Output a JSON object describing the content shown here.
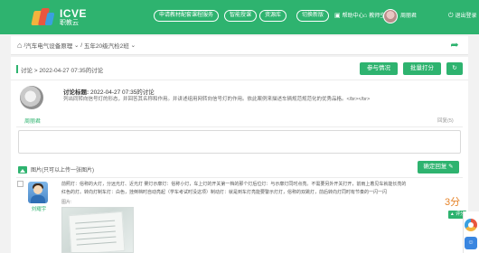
{
  "brand": {
    "name_en": "ICVE",
    "name_cn": "职教云"
  },
  "nav": {
    "pill_links": [
      "申请教材配套课程服务",
      "智能授课",
      "资源库",
      "切换新版"
    ],
    "help": "帮助中心",
    "teacher_space": "教师空间",
    "username": "周丽君",
    "logout": "退出登录"
  },
  "breadcrumb": {
    "course": "汽车电气设备原理",
    "clazz": "五年20级汽检2班"
  },
  "topic": {
    "crumb": "讨论  > 2022-04-27 07:35的讨论",
    "btn_participation": "参与情况",
    "btn_batch_score": "批量打分",
    "btn_refresh_icon": "↻",
    "author": "周丽君",
    "title_label": "讨论标题:",
    "title_value": "2022-04-27 07:35的讨论",
    "body": "列出同转向信号灯的形态，并回答其名称和作用。并讲述组用网转向信号灯的作用。依此案例来描述车辆规范规范化的优秀品格。</br></br>",
    "reply_count_label": "回复(5)"
  },
  "reply_editor": {
    "upload_hint": "图片(只可以上传一张图片)",
    "submit_label": "确定回复 ✎"
  },
  "replies": [
    {
      "name": "刘耀宇",
      "line1": "前照灯：俗称的大灯，分远光灯、近光灯 雾灯示廓灯：俗称小灯，车上灯的开关第一档的那个灯后位灯：与示廓灯同时点亮。不需要另外开关打开，前雨上着见车就能长亮的",
      "line2": "红色的灯。转向灯制车灯：白色，挂倒档时自动亮起（学车考试时没这项）制动灯：就是到车灯亮能要警示灯灯，俗称的双跳灯，前后转向灯同时有节奏的一闪一闪",
      "image_label": "图片:",
      "score": "3分",
      "score_btn": "▲ 评分"
    }
  ]
}
